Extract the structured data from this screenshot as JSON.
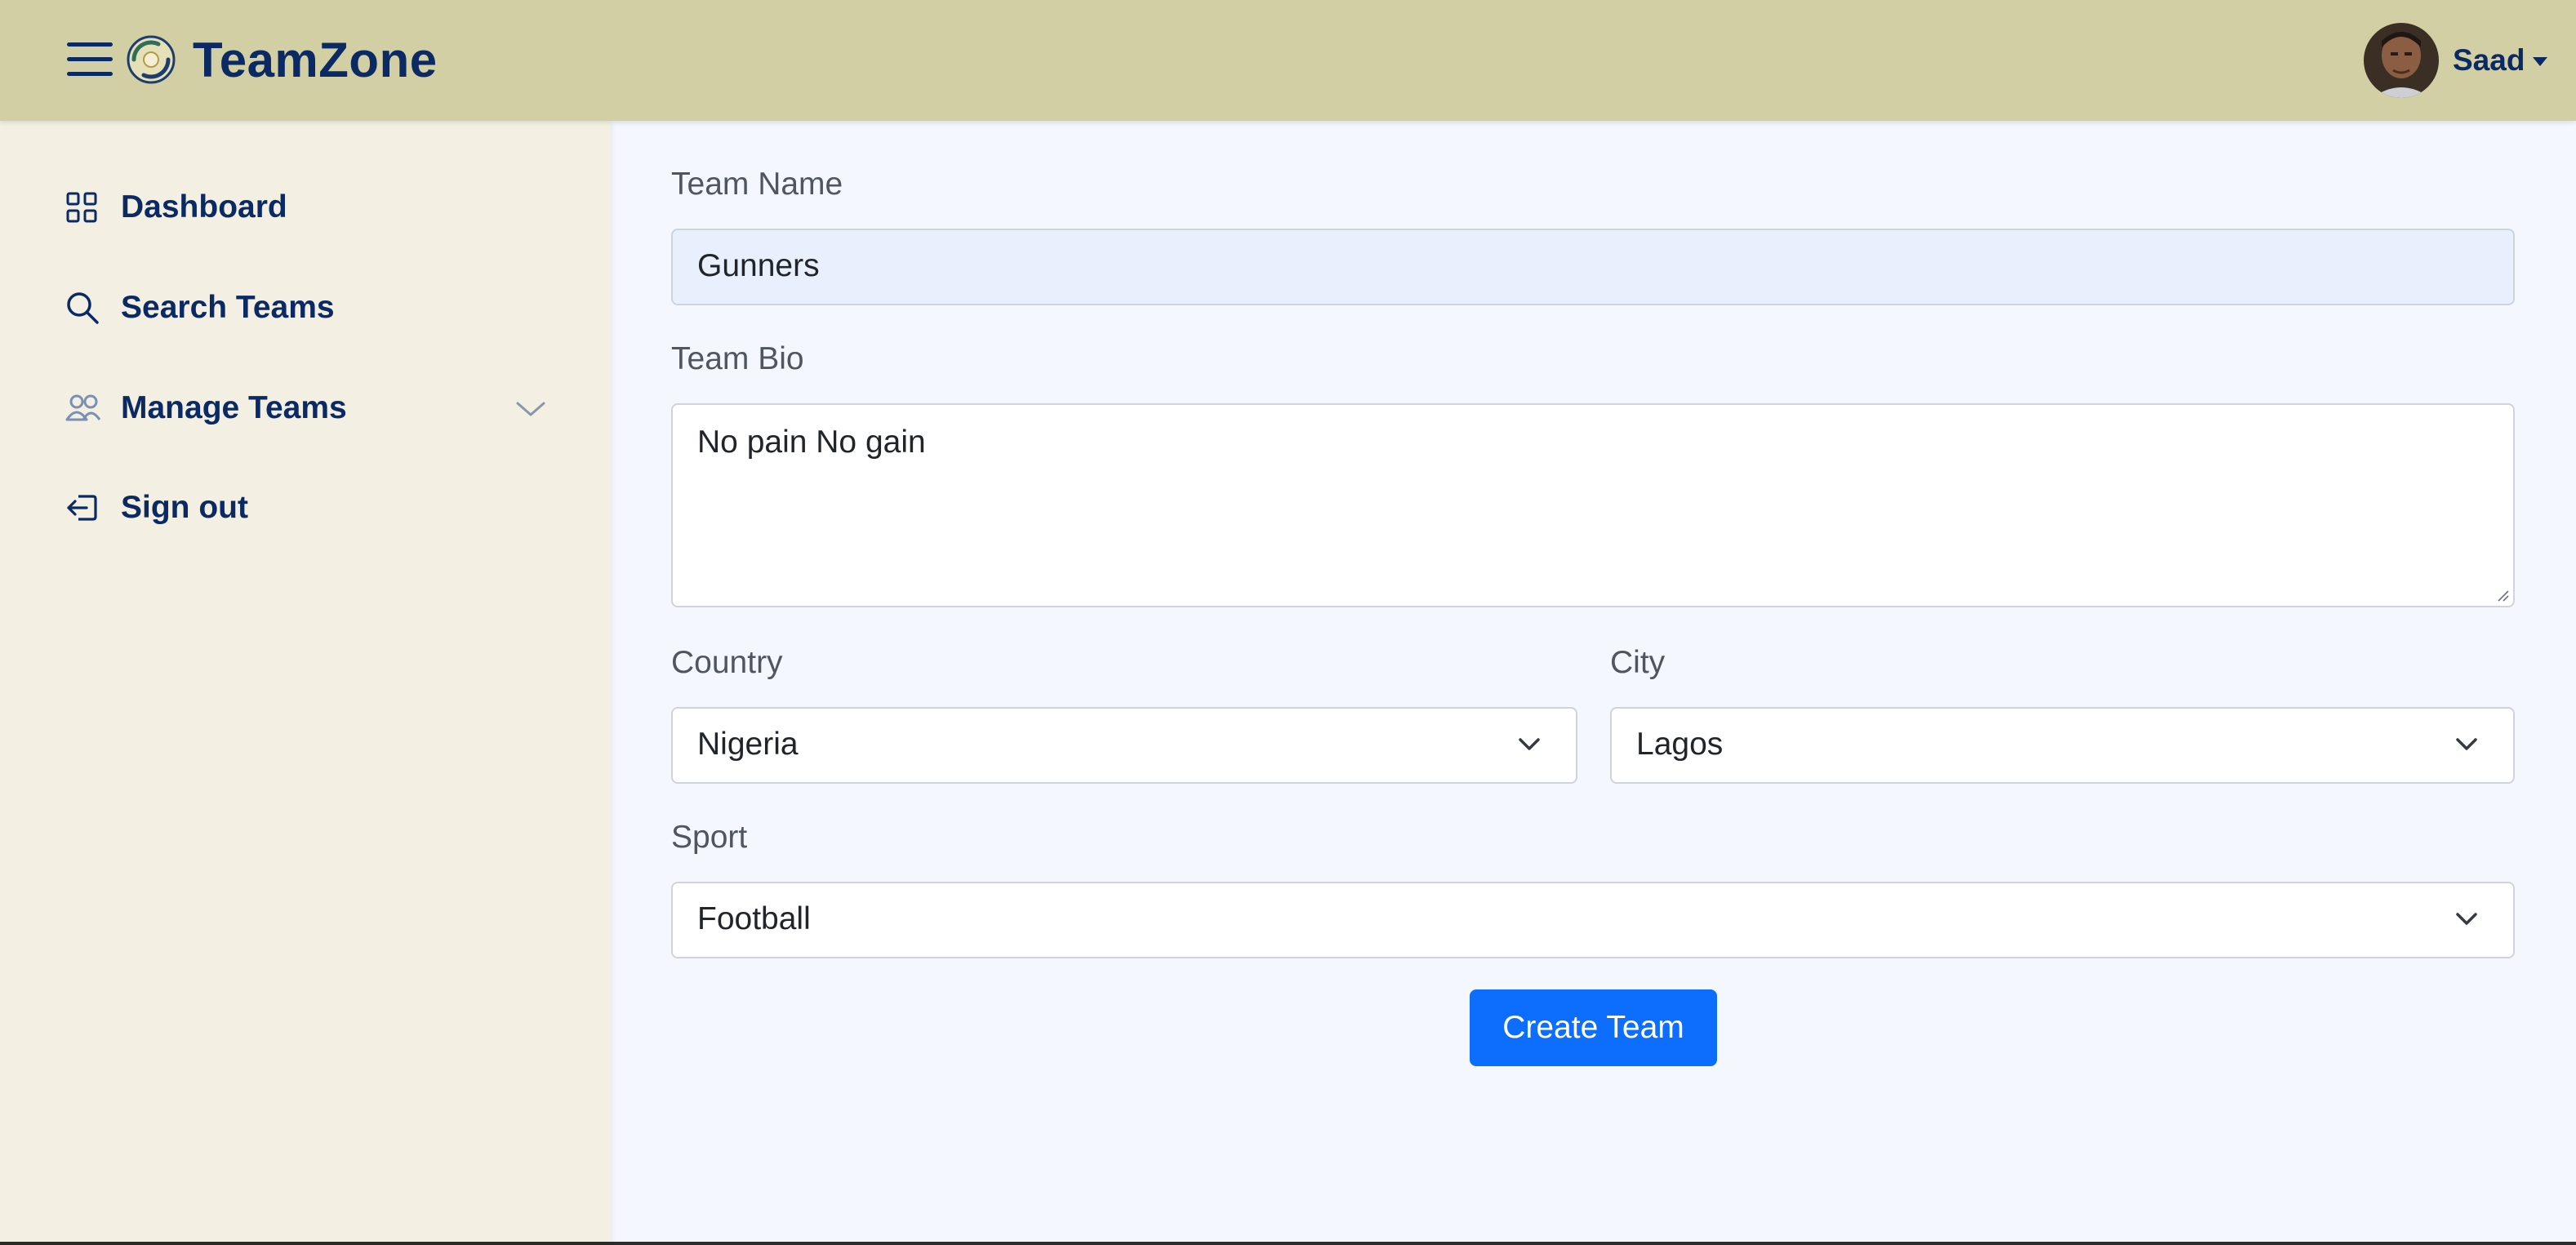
{
  "app": {
    "brand": "TeamZone",
    "hamburger_icon": "hamburger-menu-icon",
    "logo_icon": "teamzone-logo"
  },
  "user": {
    "name": "Saad",
    "avatar_icon": "user-avatar"
  },
  "sidebar": {
    "items": [
      {
        "label": "Dashboard",
        "icon": "grid-icon"
      },
      {
        "label": "Search Teams",
        "icon": "search-icon"
      },
      {
        "label": "Manage Teams",
        "icon": "users-icon",
        "expandable": true
      },
      {
        "label": "Sign out",
        "icon": "sign-out-icon"
      }
    ]
  },
  "form": {
    "team_name": {
      "label": "Team Name",
      "value": "Gunners"
    },
    "team_bio": {
      "label": "Team Bio",
      "value": "No pain No gain"
    },
    "country": {
      "label": "Country",
      "value": "Nigeria"
    },
    "city": {
      "label": "City",
      "value": "Lagos"
    },
    "sport": {
      "label": "Sport",
      "value": "Football"
    },
    "submit_label": "Create Team"
  },
  "colors": {
    "navbar_bg": "#d3cfa4",
    "sidebar_bg": "#f3f0e3",
    "main_bg": "#f4f7fd",
    "brand_text": "#0b2a63",
    "primary_button": "#0d6efd",
    "autofill_bg": "#e8f0fe"
  }
}
